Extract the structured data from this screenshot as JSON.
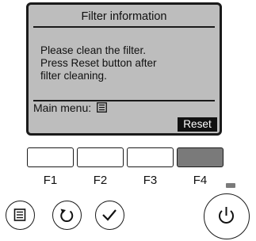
{
  "screen": {
    "title": "Filter information",
    "message_lines": [
      "Please clean the filter.",
      "Press Reset button after",
      "filter cleaning."
    ],
    "footer_label": "Main menu:",
    "footer_icon": "menu-icon",
    "reset_label": "Reset"
  },
  "function_keys": [
    {
      "label": "F1",
      "active": false
    },
    {
      "label": "F2",
      "active": false
    },
    {
      "label": "F3",
      "active": false
    },
    {
      "label": "F4",
      "active": true
    }
  ],
  "buttons": {
    "menu": "menu-icon",
    "return": "return-icon",
    "select": "checkmark-icon",
    "power": "power-icon"
  },
  "colors": {
    "lcd_background": "#bdbdbd",
    "active_key": "#7a7a7a",
    "outline": "#1a1a1a"
  }
}
